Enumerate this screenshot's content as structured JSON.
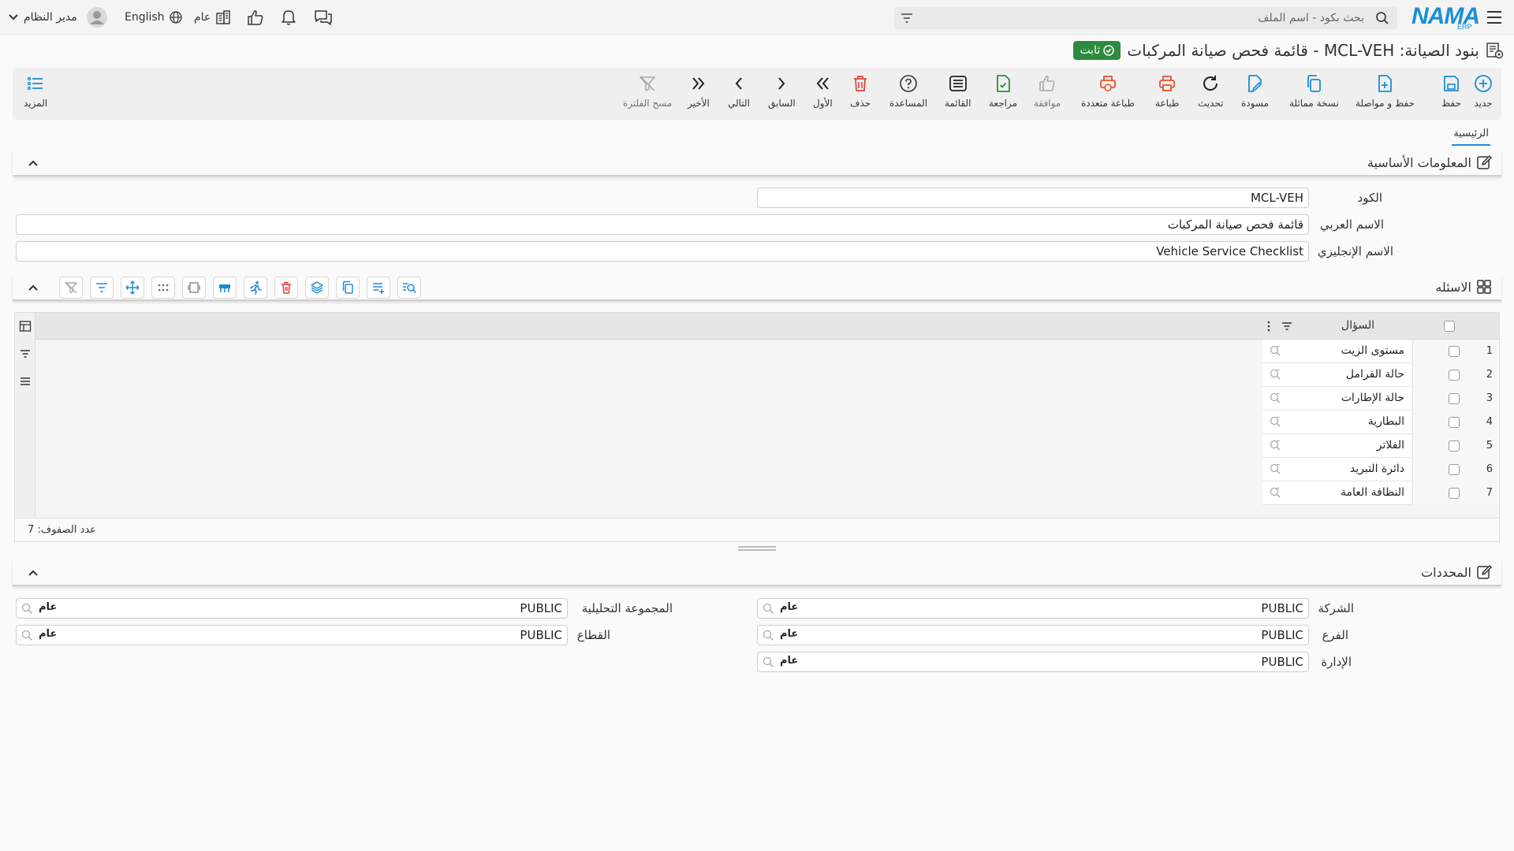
{
  "topbar": {
    "user_name": "مدير النظام",
    "language": "English",
    "scope": "عام",
    "search_placeholder": "بحث بكود - اسم الملف",
    "logo_main": "NAMA",
    "logo_sub": "ERP"
  },
  "page": {
    "title": "بنود الصيانة: MCL-VEH - قائمة فحص صيانة المركبات",
    "status_badge": "ثابت"
  },
  "toolbar": {
    "new": "جديد",
    "save": "حفظ",
    "save_continue": "حفظ و مواصلة",
    "duplicate": "نسخة مماثلة",
    "draft": "مسودة",
    "refresh": "تحديث",
    "print": "طباعة",
    "multi_print": "طباعة متعددة",
    "approve": "موافقة",
    "review": "مراجعة",
    "list": "القائمة",
    "help": "المساعدة",
    "delete": "حذف",
    "first": "الأول",
    "previous": "السابق",
    "next": "التالي",
    "last": "الأخير",
    "clear_filter": "مسح الفلترة",
    "more": "المزيد"
  },
  "tabs": {
    "main": "الرئيسية"
  },
  "basic_info": {
    "title": "المعلومات الأساسية",
    "code_label": "الكود",
    "code_value": "MCL-VEH",
    "arabic_name_label": "الاسم العربي",
    "arabic_name_value": "قائمة فحص صيانة المركبات",
    "english_name_label": "الاسم الإنجليزي",
    "english_name_value": "Vehicle Service Checklist"
  },
  "questions": {
    "title": "الاسئله",
    "column_header": "السؤال",
    "rows": [
      {
        "num": "1",
        "question": "مستوى الزيت"
      },
      {
        "num": "2",
        "question": "حالة الفرامل"
      },
      {
        "num": "3",
        "question": "حالة الإطارات"
      },
      {
        "num": "4",
        "question": "البطارية"
      },
      {
        "num": "5",
        "question": "الفلاتر"
      },
      {
        "num": "6",
        "question": "دائرة التبريد"
      },
      {
        "num": "7",
        "question": "النظافة العامة"
      }
    ],
    "row_count": "عدد الصفوف: 7"
  },
  "dimensions": {
    "title": "المحددات",
    "company_label": "الشركة",
    "company_value": "PUBLIC",
    "company_tag": "عام",
    "branch_label": "الفرع",
    "branch_value": "PUBLIC",
    "branch_tag": "عام",
    "department_label": "الإدارة",
    "department_value": "PUBLIC",
    "department_tag": "عام",
    "analysis_group_label": "المجموعة التحليلية",
    "analysis_group_value": "PUBLIC",
    "analysis_group_tag": "عام",
    "sector_label": "القطاع",
    "sector_value": "PUBLIC",
    "sector_tag": "عام"
  },
  "colors": {
    "brand": "#1a8fd6",
    "badge": "#2e8b3e",
    "print": "#e8502f",
    "delete": "#e0433a",
    "grid_icon": "#1a8fd6"
  }
}
